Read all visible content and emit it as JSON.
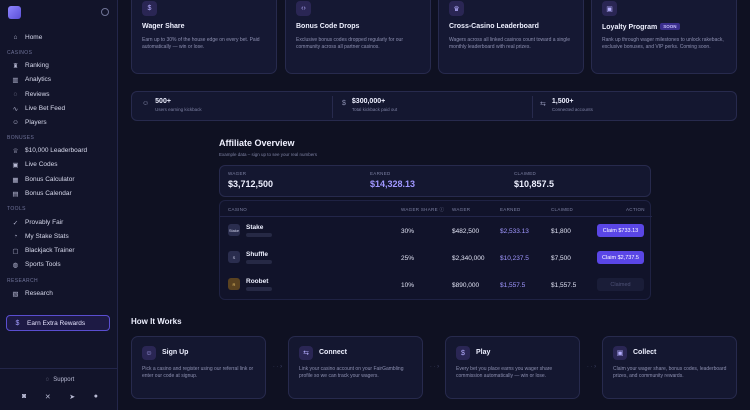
{
  "sidebar": {
    "sections": [
      {
        "label": "",
        "items": [
          {
            "label": "Home",
            "icon": "home-icon",
            "glyph": "⌂"
          }
        ]
      },
      {
        "label": "CASINOS",
        "items": [
          {
            "label": "Ranking",
            "icon": "trophy-icon",
            "glyph": "♜"
          },
          {
            "label": "Analytics",
            "icon": "bar-chart-icon",
            "glyph": "▥"
          },
          {
            "label": "Reviews",
            "icon": "chat-icon",
            "glyph": "◌"
          },
          {
            "label": "Live Bet Feed",
            "icon": "pulse-icon",
            "glyph": "∿"
          },
          {
            "label": "Players",
            "icon": "user-icon",
            "glyph": "☺"
          }
        ]
      },
      {
        "label": "BONUSES",
        "items": [
          {
            "label": "$10,000 Leaderboard",
            "icon": "medal-icon",
            "glyph": "♕"
          },
          {
            "label": "Live Codes",
            "icon": "gift-icon",
            "glyph": "▣"
          },
          {
            "label": "Bonus Calculator",
            "icon": "calculator-icon",
            "glyph": "▦"
          },
          {
            "label": "Bonus Calendar",
            "icon": "calendar-icon",
            "glyph": "▤"
          }
        ]
      },
      {
        "label": "TOOLS",
        "items": [
          {
            "label": "Provably Fair",
            "icon": "check-icon",
            "glyph": "✓"
          },
          {
            "label": "My Stake Stats",
            "icon": "stats-icon",
            "glyph": "◔"
          },
          {
            "label": "Blackjack Trainer",
            "icon": "cards-icon",
            "glyph": "▢"
          },
          {
            "label": "Sports Tools",
            "icon": "ball-icon",
            "glyph": "◍"
          }
        ]
      },
      {
        "label": "RESEARCH",
        "items": [
          {
            "label": "Research",
            "icon": "book-icon",
            "glyph": "▧"
          }
        ]
      }
    ],
    "earn_label": "Earn Extra Rewards",
    "support_label": "Support"
  },
  "features": [
    {
      "title": "Wager Share",
      "badge": "",
      "icon": "dollar-icon",
      "glyph": "$",
      "desc": "Earn up to 30% of the house edge on every bet. Paid automatically — win or lose."
    },
    {
      "title": "Bonus Code Drops",
      "badge": "",
      "icon": "code-icon",
      "glyph": "‹›",
      "desc": "Exclusive bonus codes dropped regularly for our community across all partner casinos."
    },
    {
      "title": "Cross-Casino Leaderboard",
      "badge": "",
      "icon": "trophy-icon",
      "glyph": "♛",
      "desc": "Wagers across all linked casinos count toward a single monthly leaderboard with real prizes."
    },
    {
      "title": "Loyalty Program",
      "badge": "SOON",
      "icon": "gift-icon",
      "glyph": "▣",
      "desc": "Rank up through wager milestones to unlock rakeback, exclusive bonuses, and VIP perks. Coming soon."
    }
  ],
  "stats": [
    {
      "value": "500+",
      "label": "Users earning kickback",
      "icon": "users-icon",
      "glyph": "☺"
    },
    {
      "value": "$300,000+",
      "label": "Total kickback paid out",
      "icon": "dollar-icon",
      "glyph": "$"
    },
    {
      "value": "1,500+",
      "label": "Connected accounts",
      "icon": "link-icon",
      "glyph": "⇆"
    }
  ],
  "affiliate": {
    "title": "Affiliate Overview",
    "subtitle": "Example data – sign up to see your real numbers",
    "totals": [
      {
        "label": "WAGER",
        "value": "$3,712,500"
      },
      {
        "label": "EARNED",
        "value": "$14,328.13"
      },
      {
        "label": "CLAIMED",
        "value": "$10,857.5"
      }
    ],
    "columns": [
      "CASINO",
      "WAGER SHARE ⓘ",
      "WAGER",
      "EARNED",
      "CLAIMED",
      "ACTION"
    ],
    "rows": [
      {
        "casino": "Stake",
        "logo": "Stake",
        "share": "30%",
        "wager": "$482,500",
        "earned": "$2,533.13",
        "claimed": "$1,800",
        "action": "Claim $733.13",
        "claimable": true
      },
      {
        "casino": "Shuffle",
        "logo": "S",
        "share": "25%",
        "wager": "$2,340,000",
        "earned": "$10,237.5",
        "claimed": "$7,500",
        "action": "Claim $2,737.5",
        "claimable": true
      },
      {
        "casino": "Roobet",
        "logo": "R",
        "share": "10%",
        "wager": "$890,000",
        "earned": "$1,557.5",
        "claimed": "$1,557.5",
        "action": "Claimed",
        "claimable": false
      }
    ]
  },
  "how_it_works": {
    "title": "How It Works",
    "steps": [
      {
        "title": "Sign Up",
        "icon": "user-plus-icon",
        "glyph": "☺",
        "desc": "Pick a casino and register using our referral link or enter our code at signup."
      },
      {
        "title": "Connect",
        "icon": "link-icon",
        "glyph": "⇆",
        "desc": "Link your casino account on your FairGambling profile so we can track your wagers."
      },
      {
        "title": "Play",
        "icon": "dollar-icon",
        "glyph": "$",
        "desc": "Every bet you place earns you wager share commission automatically — win or lose."
      },
      {
        "title": "Collect",
        "icon": "gift-icon",
        "glyph": "▣",
        "desc": "Claim your wager share, bonus codes, leaderboard prizes, and community rewards."
      }
    ]
  },
  "colors": {
    "accent": "#5a46e6",
    "accent_text": "#a097ff",
    "background": "#0f1122"
  }
}
